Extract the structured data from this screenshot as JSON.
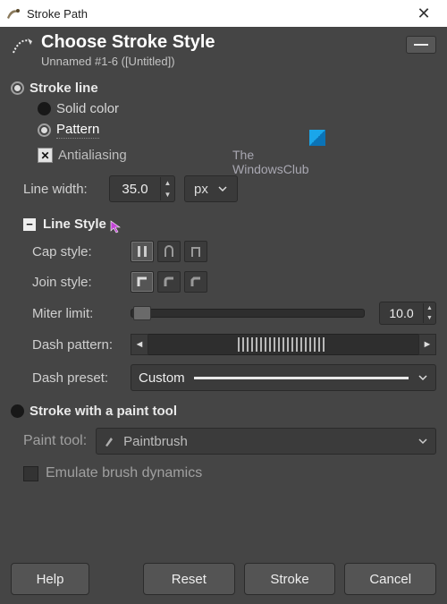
{
  "window": {
    "title": "Stroke Path"
  },
  "header": {
    "title": "Choose Stroke Style",
    "subtitle": "Unnamed #1-6 ([Untitled])"
  },
  "sections": {
    "stroke_line": {
      "title": "Stroke line",
      "options": {
        "solid": "Solid color",
        "pattern": "Pattern"
      },
      "antialiasing": "Antialiasing",
      "line_width": {
        "label": "Line width:",
        "value": "35.0",
        "unit": "px"
      },
      "line_style": {
        "title": "Line Style",
        "cap": "Cap style:",
        "join": "Join style:",
        "miter": "Miter limit:",
        "miter_value": "10.0",
        "dash_pattern": "Dash pattern:",
        "dash_preset": "Dash preset:",
        "dash_preset_value": "Custom"
      }
    },
    "paint_tool": {
      "title": "Stroke with a paint tool",
      "tool_label": "Paint tool:",
      "tool_value": "Paintbrush",
      "emulate": "Emulate brush dynamics"
    }
  },
  "watermark": {
    "line1": "The",
    "line2": "WindowsClub"
  },
  "buttons": {
    "help": "Help",
    "reset": "Reset",
    "stroke": "Stroke",
    "cancel": "Cancel"
  }
}
